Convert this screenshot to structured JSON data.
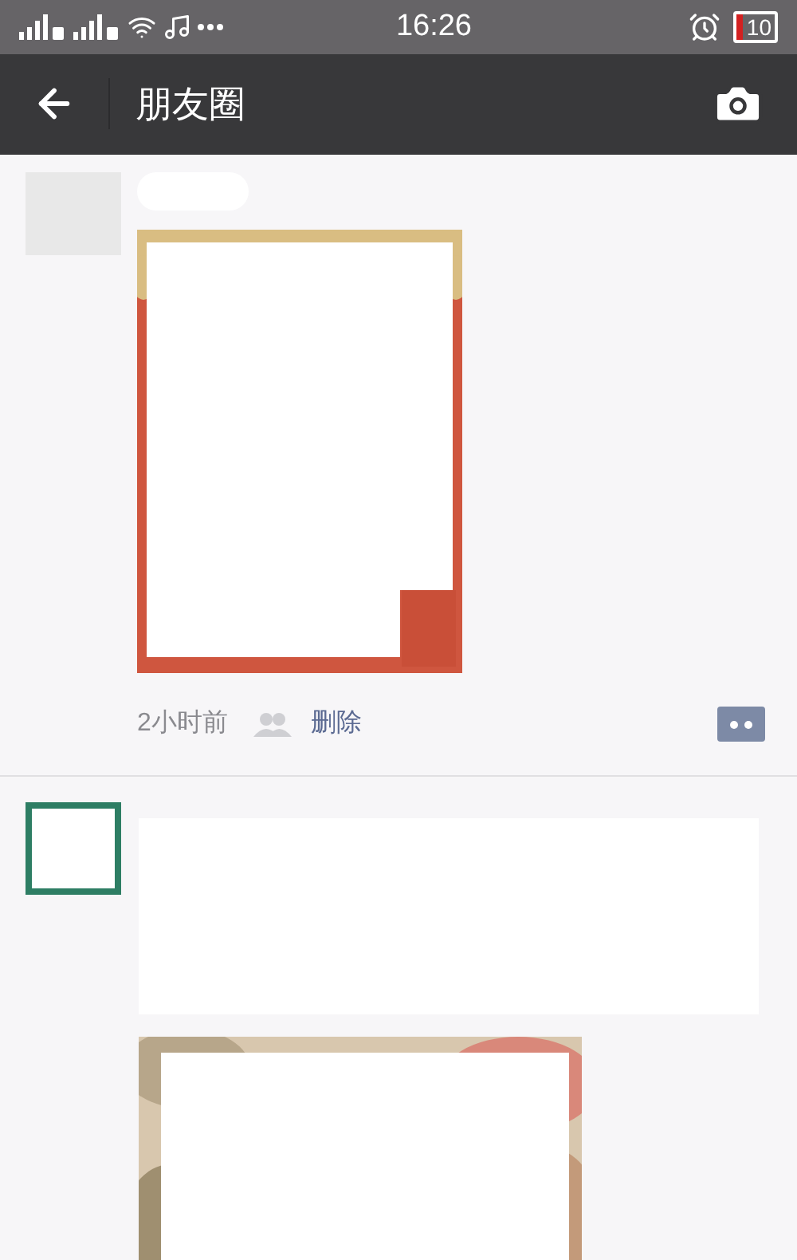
{
  "status_bar": {
    "time": "16:26",
    "battery": "10"
  },
  "header": {
    "title": "朋友圈"
  },
  "posts": [
    {
      "kind": "own",
      "time": "2小时前",
      "delete_label": "删除"
    },
    {
      "kind": "other"
    }
  ]
}
